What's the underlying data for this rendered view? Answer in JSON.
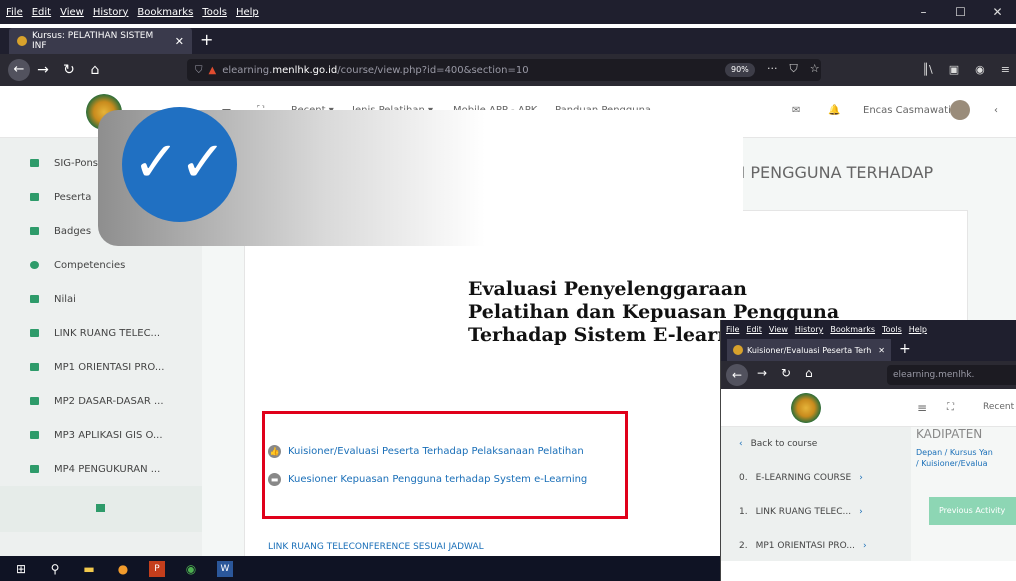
{
  "menu": [
    "File",
    "Edit",
    "View",
    "History",
    "Bookmarks",
    "Tools",
    "Help"
  ],
  "tab": {
    "title": "Kursus: PELATIHAN SISTEM INF"
  },
  "url": {
    "pre": "elearning.",
    "host": "menlhk.go.id",
    "path": "/course/view.php?id=400&section=10"
  },
  "zoom": "90%",
  "topnav": {
    "recent": "Recent",
    "jenis": "Jenis Pelatihan",
    "mobile": "Mobile APP - APK",
    "panduan": "Panduan Pengguna",
    "user": "Encas Casmawati"
  },
  "sidebar": [
    "SIG-Ponsel",
    "Peserta",
    "Badges",
    "Competencies",
    "Nilai",
    "LINK RUANG TELEC...",
    "MP1 ORIENTASI PRO...",
    "MP2 DASAR-DASAR ...",
    "MP3 APLIKASI GIS O...",
    "MP4 PENGUKURAN ..."
  ],
  "page_title": "EVALUASI PENYELENGGARAAN PELATIHAN DAN KEPUASAN PENGGUNA TERHADAP SYSTEM E-LEARNING",
  "banner": {
    "line1": "Evaluasi Penyelenggaraan",
    "line2": "Pelatihan dan Kepuasan Pengguna",
    "line3": "Terhadap Sistem E-learning"
  },
  "links": [
    "Kuisioner/Evaluasi Peserta Terhadap Pelaksanaan Pelatihan",
    "Kuesioner Kepuasan Pengguna terhadap System e-Learning"
  ],
  "bottom_link": "LINK RUANG TELECONFERENCE SESUAI JADWAL",
  "win2": {
    "tab": "Kuisioner/Evaluasi Peserta Terh",
    "url": "elearning.menlhk.",
    "recent": "Recent",
    "heading": "KADIPATEN",
    "breadcrumb": "Depan / Kursus Yan",
    "breadcrumb2": "/ Kuisioner/Evalua",
    "sidebar": [
      "Back to course",
      "E-LEARNING COURSE",
      "LINK RUANG TELEC...",
      "MP1 ORIENTASI PRO..."
    ],
    "prefix": [
      "",
      "0.",
      "1.",
      "2."
    ],
    "prev": "Previous Activity"
  }
}
